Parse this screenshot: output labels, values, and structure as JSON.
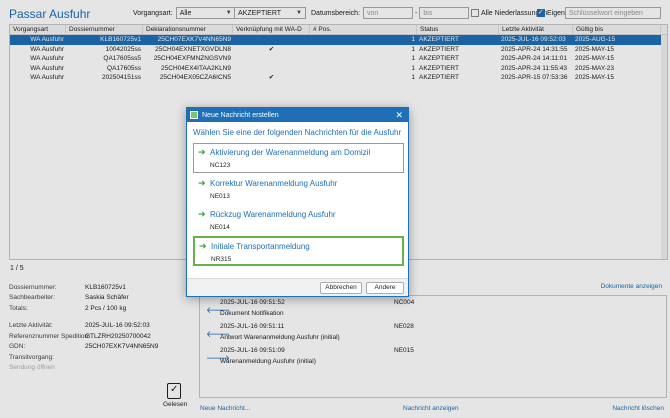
{
  "app": {
    "title": "Passar Ausfuhr"
  },
  "filters": {
    "vorgangsart_label": "Vorgangsart:",
    "vorgangsart_value": "Alle",
    "status_value": "AKZEPTIERT",
    "datumsbereich_label": "Datumsbereich:",
    "von_placeholder": "von",
    "bis_placeholder": "bis",
    "alle_niederlassungen_label": "Alle Niederlassungen",
    "eigene_label": "Eigene",
    "search_placeholder": "Schlüsselwort eingeben"
  },
  "grid": {
    "columns": [
      "Vorgangsart",
      "Dossiernummer",
      "Deklarationsnummer",
      "Verknüpfung mit WA-D",
      "# Pos.",
      "Status",
      "Letzte Aktivität",
      "Gültig bis"
    ],
    "rows": [
      [
        "WA Ausfuhr",
        "KLB160725v1",
        "25CH07EXK7V4NN65N9",
        "",
        "1",
        "AKZEPTIERT",
        "2025-JUL-16 09:52:03",
        "2025-AUG-15"
      ],
      [
        "WA Ausfuhr",
        "10042025ss",
        "25CH04EXNETXGVDLN8",
        "✔",
        "1",
        "AKZEPTIERT",
        "2025-APR-24 14:31:55",
        "2025-MAY-15"
      ],
      [
        "WA Ausfuhr",
        "QA17605ss5",
        "25CH04EXFMNZNGSVN9",
        "",
        "1",
        "AKZEPTIERT",
        "2025-APR-24 14:11:01",
        "2025-MAY-15"
      ],
      [
        "WA Ausfuhr",
        "QA17605ss",
        "25CH04EX4ITAA2KLN9",
        "",
        "1",
        "AKZEPTIERT",
        "2025-APR-24 11:55:43",
        "2025-MAY-23"
      ],
      [
        "WA Ausfuhr",
        "202504151ss",
        "25CH04EX05CZA6ICN5",
        "✔",
        "1",
        "AKZEPTIERT",
        "2025-APR-15 07:53:36",
        "2025-MAY-15"
      ]
    ],
    "pager": "1 / 5"
  },
  "details": {
    "dossiernummer_label": "Dossiernummer:",
    "dossiernummer_value": "KLB160725v1",
    "sachbearbeiter_label": "Sachbearbeiter:",
    "sachbearbeiter_value": "Saskia Schäfer",
    "totals_label": "Totals:",
    "totals_value": "2 Pcs / 100 kg",
    "letzte_label": "Letzte Aktivität:",
    "letzte_value": "2025-JUL-16 09:52:03",
    "referenz_label": "Referenznummer Spedition:",
    "referenz_value": "GTLZRH20250700042",
    "gdn_label": "GDN:",
    "gdn_value": "25CH07EXK7V4NN65N9",
    "transit_label": "Transitvorgang:",
    "sendung_label": "Sendung öffnen",
    "gelesen_label": "Gelesen"
  },
  "messages": {
    "docs_link": "Dokumente anzeigen",
    "items": [
      {
        "ts": "2025-JUL-16 09:51:52",
        "code": "NC004",
        "name": "Dokument Notifikation"
      },
      {
        "ts": "2025-JUL-16 09:51:11",
        "code": "NE028",
        "name": "Antwort Warenanmeldung Ausfuhr (initial)"
      },
      {
        "ts": "2025-JUL-16 09:51:09",
        "code": "NE015",
        "name": "Warenanmeldung Ausfuhr (initial)"
      }
    ],
    "new_link": "Neue Nachricht...",
    "show_link": "Nachricht anzeigen",
    "delete_link": "Nachricht löschen"
  },
  "dialog": {
    "title": "Neue Nachricht erstellen",
    "subtitle": "Wählen Sie eine der folgenden Nachrichten für die Ausfuhr",
    "options": [
      {
        "label": "Aktivierung der Warenanmeldung am Domizil",
        "code": "NC123"
      },
      {
        "label": "Korrektur Warenanmeldung Ausfuhr",
        "code": "NE013"
      },
      {
        "label": "Rückzug Warenanmeldung Ausfuhr",
        "code": "NE014"
      },
      {
        "label": "Initiale Transportanmeldung",
        "code": "NR315"
      }
    ],
    "cancel_label": "Abbrechen",
    "other_label": "Andere"
  }
}
